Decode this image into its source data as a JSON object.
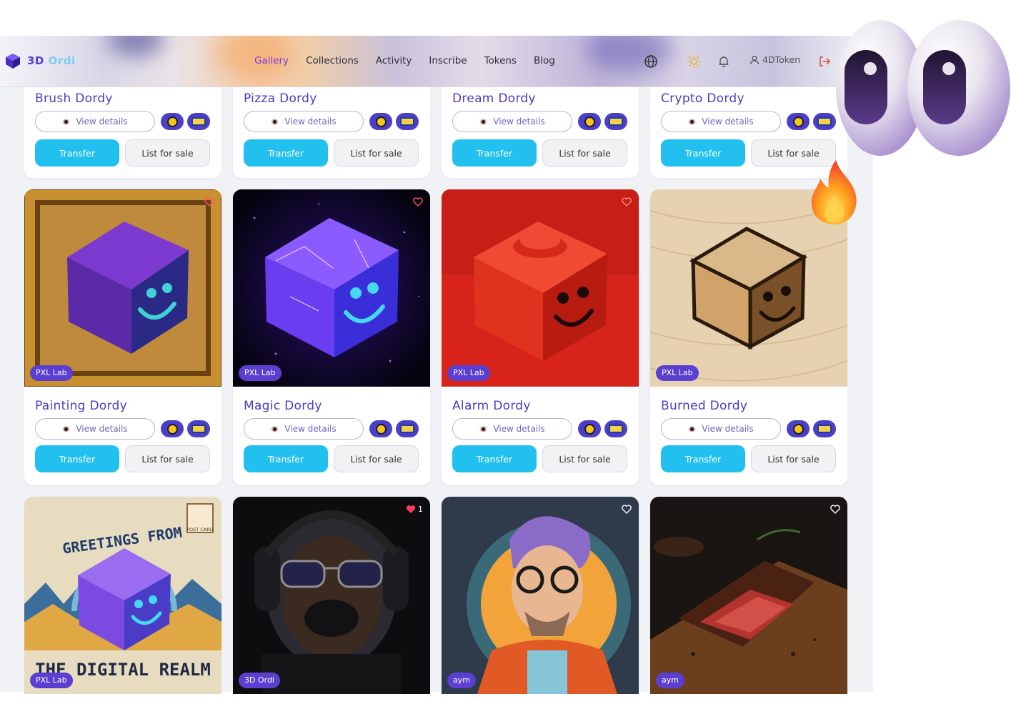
{
  "app": {
    "logo_text_a": "3D",
    "logo_text_b": "Ordi"
  },
  "nav": {
    "links": [
      "Gallery",
      "Collections",
      "Activity",
      "Inscribe",
      "Tokens",
      "Blog"
    ],
    "active": "Gallery",
    "user_name": "4DToken"
  },
  "card_labels": {
    "view_details": "View details",
    "transfer": "Transfer",
    "list_for_sale": "List for sale"
  },
  "row1": [
    {
      "title": "Brush Dordy"
    },
    {
      "title": "Pizza Dordy"
    },
    {
      "title": "Dream Dordy"
    },
    {
      "title": "Crypto Dordy"
    }
  ],
  "row2": [
    {
      "title": "Painting Dordy",
      "badge": "PXL Lab"
    },
    {
      "title": "Magic Dordy",
      "badge": "PXL Lab"
    },
    {
      "title": "Alarm Dordy",
      "badge": "PXL Lab"
    },
    {
      "title": "Burned Dordy",
      "badge": "PXL Lab"
    }
  ],
  "row3": [
    {
      "badge": "PXL Lab",
      "image_text_top": "GREETINGS FROM",
      "image_text_bottom": "THE DIGITAL REALM",
      "stamp_text": "POST CARD"
    },
    {
      "badge": "3D Ordi",
      "likes": "1"
    },
    {
      "badge": "aym"
    },
    {
      "badge": "aym"
    }
  ],
  "colors": {
    "accent": "#5b3fd1",
    "transfer": "#22c0ee",
    "title": "#4c3cc4",
    "active_nav": "#7b3fe4"
  }
}
